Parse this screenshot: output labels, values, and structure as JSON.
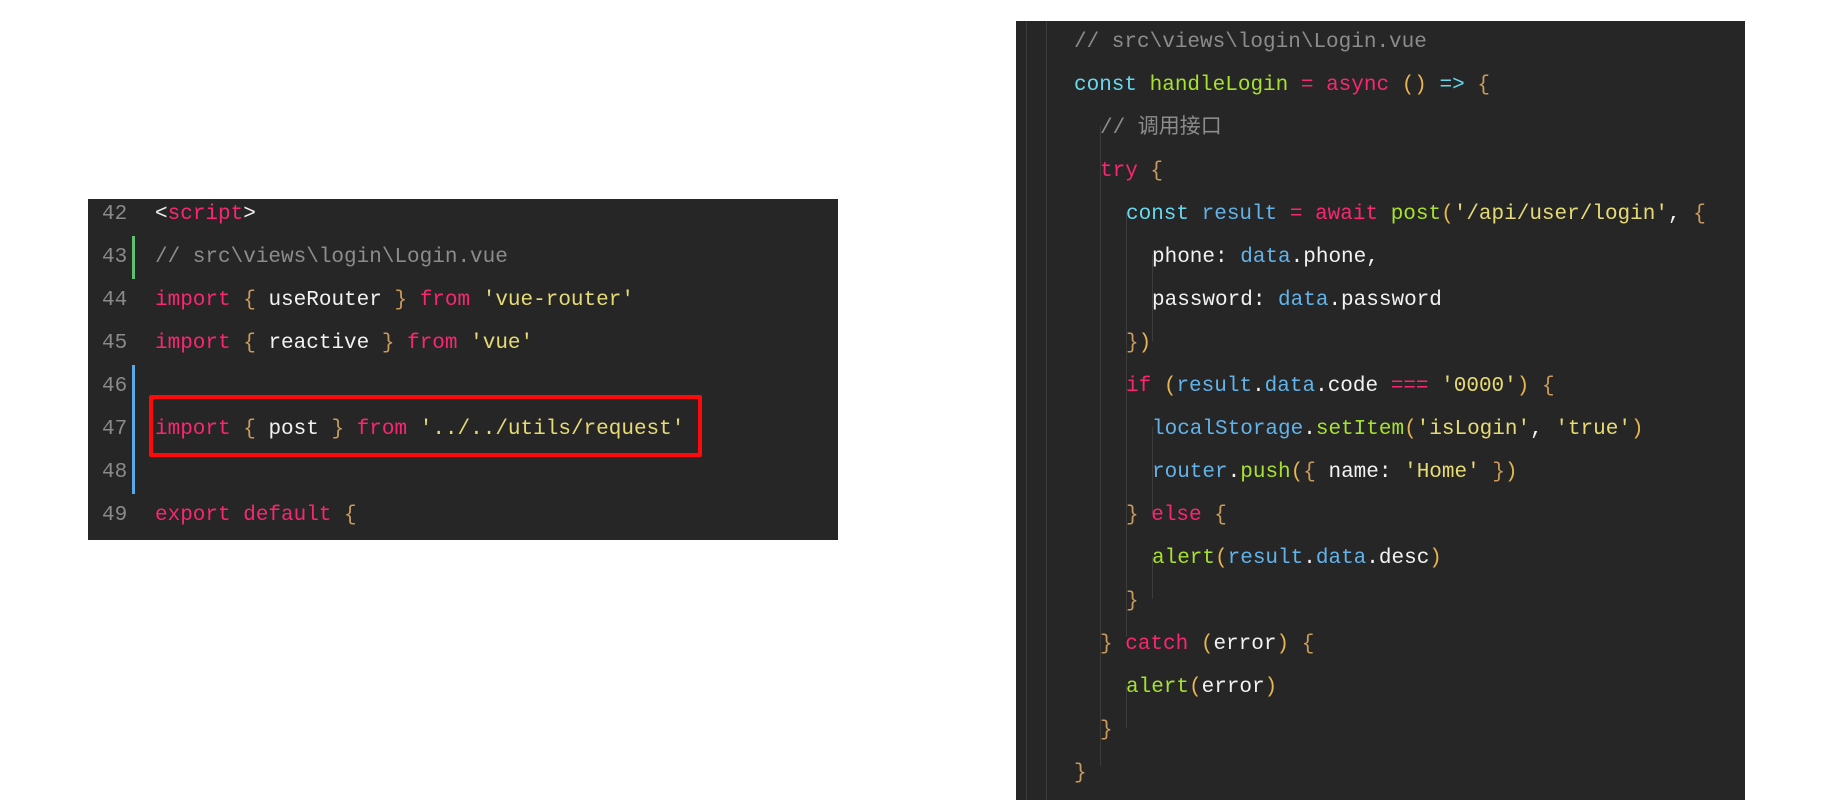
{
  "left_snippet": {
    "lines": [
      {
        "num": "42",
        "tokens": [
          {
            "t": "<",
            "c": "punct"
          },
          {
            "t": "script",
            "c": "tag"
          },
          {
            "t": ">",
            "c": "punct"
          }
        ]
      },
      {
        "num": "43",
        "git": "added",
        "tokens": [
          {
            "t": "// src\\views\\login\\Login.vue",
            "c": "cm"
          }
        ]
      },
      {
        "num": "44",
        "tokens": [
          {
            "t": "import",
            "c": "kw"
          },
          {
            "t": " ",
            "c": "id"
          },
          {
            "t": "{",
            "c": "br"
          },
          {
            "t": " useRouter ",
            "c": "id"
          },
          {
            "t": "}",
            "c": "br"
          },
          {
            "t": " ",
            "c": "id"
          },
          {
            "t": "from",
            "c": "kw"
          },
          {
            "t": " ",
            "c": "id"
          },
          {
            "t": "'vue-router'",
            "c": "str"
          }
        ]
      },
      {
        "num": "45",
        "tokens": [
          {
            "t": "import",
            "c": "kw"
          },
          {
            "t": " ",
            "c": "id"
          },
          {
            "t": "{",
            "c": "br"
          },
          {
            "t": " reactive ",
            "c": "id"
          },
          {
            "t": "}",
            "c": "br"
          },
          {
            "t": " ",
            "c": "id"
          },
          {
            "t": "from",
            "c": "kw"
          },
          {
            "t": " ",
            "c": "id"
          },
          {
            "t": "'vue'",
            "c": "str"
          }
        ]
      },
      {
        "num": "46",
        "git": "modified",
        "tokens": []
      },
      {
        "num": "47",
        "git": "modified",
        "tokens": [
          {
            "t": "import",
            "c": "kw"
          },
          {
            "t": " ",
            "c": "id"
          },
          {
            "t": "{",
            "c": "br"
          },
          {
            "t": " post ",
            "c": "id"
          },
          {
            "t": "}",
            "c": "br"
          },
          {
            "t": " ",
            "c": "id"
          },
          {
            "t": "from",
            "c": "kw"
          },
          {
            "t": " ",
            "c": "id"
          },
          {
            "t": "'../../utils/request'",
            "c": "str"
          }
        ]
      },
      {
        "num": "48",
        "git": "modified",
        "tokens": []
      },
      {
        "num": "49",
        "tokens": [
          {
            "t": "export default",
            "c": "kw"
          },
          {
            "t": " ",
            "c": "id"
          },
          {
            "t": "{",
            "c": "br"
          }
        ]
      }
    ],
    "highlight_color": "#ff0a0a",
    "git_colors": {
      "added": "#5fc06f",
      "modified": "#5aa9e6"
    }
  },
  "right_snippet": {
    "lines": [
      {
        "indent": 0,
        "tokens": [
          {
            "t": "// src\\views\\login\\Login.vue",
            "c": "cm"
          }
        ]
      },
      {
        "indent": 0,
        "tokens": [
          {
            "t": "const",
            "c": "decl"
          },
          {
            "t": " ",
            "c": "id"
          },
          {
            "t": "handleLogin",
            "c": "fn"
          },
          {
            "t": " = ",
            "c": "op"
          },
          {
            "t": "async",
            "c": "kw"
          },
          {
            "t": " ",
            "c": "id"
          },
          {
            "t": "()",
            "c": "paren"
          },
          {
            "t": " => ",
            "c": "arrow"
          },
          {
            "t": "{",
            "c": "br"
          }
        ]
      },
      {
        "indent": 1,
        "tokens": [
          {
            "t": "// 调用接口",
            "c": "cm"
          }
        ]
      },
      {
        "indent": 1,
        "tokens": [
          {
            "t": "try",
            "c": "kw"
          },
          {
            "t": " ",
            "c": "id"
          },
          {
            "t": "{",
            "c": "br"
          }
        ]
      },
      {
        "indent": 2,
        "tokens": [
          {
            "t": "const",
            "c": "decl"
          },
          {
            "t": " ",
            "c": "id"
          },
          {
            "t": "result",
            "c": "var"
          },
          {
            "t": " = ",
            "c": "op"
          },
          {
            "t": "await",
            "c": "kw"
          },
          {
            "t": " ",
            "c": "id"
          },
          {
            "t": "post",
            "c": "fn"
          },
          {
            "t": "(",
            "c": "paren"
          },
          {
            "t": "'/api/user/login'",
            "c": "str"
          },
          {
            "t": ", ",
            "c": "id"
          },
          {
            "t": "{",
            "c": "br"
          }
        ]
      },
      {
        "indent": 3,
        "tokens": [
          {
            "t": "phone: ",
            "c": "id"
          },
          {
            "t": "data",
            "c": "var"
          },
          {
            "t": ".phone,",
            "c": "id"
          }
        ]
      },
      {
        "indent": 3,
        "tokens": [
          {
            "t": "password: ",
            "c": "id"
          },
          {
            "t": "data",
            "c": "var"
          },
          {
            "t": ".password",
            "c": "id"
          }
        ]
      },
      {
        "indent": 2,
        "tokens": [
          {
            "t": "}",
            "c": "br"
          },
          {
            "t": ")",
            "c": "paren"
          }
        ]
      },
      {
        "indent": 2,
        "tokens": [
          {
            "t": "if",
            "c": "kw"
          },
          {
            "t": " ",
            "c": "id"
          },
          {
            "t": "(",
            "c": "paren"
          },
          {
            "t": "result",
            "c": "var"
          },
          {
            "t": ".",
            "c": "id"
          },
          {
            "t": "data",
            "c": "var"
          },
          {
            "t": ".code ",
            "c": "id"
          },
          {
            "t": "===",
            "c": "op"
          },
          {
            "t": " ",
            "c": "id"
          },
          {
            "t": "'0000'",
            "c": "str"
          },
          {
            "t": ")",
            "c": "paren"
          },
          {
            "t": " ",
            "c": "id"
          },
          {
            "t": "{",
            "c": "br"
          }
        ]
      },
      {
        "indent": 3,
        "tokens": [
          {
            "t": "localStorage",
            "c": "var"
          },
          {
            "t": ".",
            "c": "id"
          },
          {
            "t": "setItem",
            "c": "fn"
          },
          {
            "t": "(",
            "c": "paren"
          },
          {
            "t": "'isLogin'",
            "c": "str"
          },
          {
            "t": ", ",
            "c": "id"
          },
          {
            "t": "'true'",
            "c": "str"
          },
          {
            "t": ")",
            "c": "paren"
          }
        ]
      },
      {
        "indent": 3,
        "tokens": [
          {
            "t": "router",
            "c": "var"
          },
          {
            "t": ".",
            "c": "id"
          },
          {
            "t": "push",
            "c": "fn"
          },
          {
            "t": "(",
            "c": "paren"
          },
          {
            "t": "{",
            "c": "br"
          },
          {
            "t": " name: ",
            "c": "id"
          },
          {
            "t": "'Home'",
            "c": "str"
          },
          {
            "t": " ",
            "c": "id"
          },
          {
            "t": "}",
            "c": "br"
          },
          {
            "t": ")",
            "c": "paren"
          }
        ]
      },
      {
        "indent": 2,
        "tokens": [
          {
            "t": "}",
            "c": "br"
          },
          {
            "t": " ",
            "c": "id"
          },
          {
            "t": "else",
            "c": "kw"
          },
          {
            "t": " ",
            "c": "id"
          },
          {
            "t": "{",
            "c": "br"
          }
        ]
      },
      {
        "indent": 3,
        "tokens": [
          {
            "t": "alert",
            "c": "fn"
          },
          {
            "t": "(",
            "c": "paren"
          },
          {
            "t": "result",
            "c": "var"
          },
          {
            "t": ".",
            "c": "id"
          },
          {
            "t": "data",
            "c": "var"
          },
          {
            "t": ".desc",
            "c": "id"
          },
          {
            "t": ")",
            "c": "paren"
          }
        ]
      },
      {
        "indent": 2,
        "tokens": [
          {
            "t": "}",
            "c": "br"
          }
        ]
      },
      {
        "indent": 1,
        "tokens": [
          {
            "t": "}",
            "c": "br"
          },
          {
            "t": " ",
            "c": "id"
          },
          {
            "t": "catch",
            "c": "kw"
          },
          {
            "t": " ",
            "c": "id"
          },
          {
            "t": "(",
            "c": "paren"
          },
          {
            "t": "error",
            "c": "id"
          },
          {
            "t": ")",
            "c": "paren"
          },
          {
            "t": " ",
            "c": "id"
          },
          {
            "t": "{",
            "c": "br"
          }
        ]
      },
      {
        "indent": 2,
        "tokens": [
          {
            "t": "alert",
            "c": "fn"
          },
          {
            "t": "(",
            "c": "paren"
          },
          {
            "t": "error",
            "c": "id"
          },
          {
            "t": ")",
            "c": "paren"
          }
        ]
      },
      {
        "indent": 1,
        "tokens": [
          {
            "t": "}",
            "c": "br"
          }
        ]
      },
      {
        "indent": 0,
        "tokens": [
          {
            "t": "}",
            "c": "br"
          }
        ]
      }
    ]
  }
}
